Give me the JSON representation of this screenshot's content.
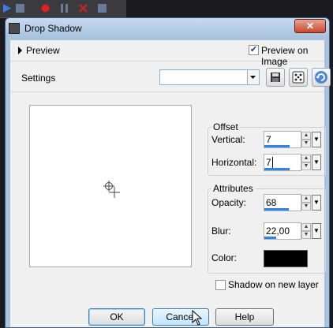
{
  "window": {
    "title": "Drop Shadow",
    "close_symbol": "✕"
  },
  "preview": {
    "expander_label": "Preview",
    "preview_on_image_label": "Preview on Image",
    "preview_on_image_checked": true
  },
  "settings": {
    "label": "Settings",
    "value": ""
  },
  "offset": {
    "group_label": "Offset",
    "vertical_label": "Vertical:",
    "vertical_value": "7",
    "horizontal_label": "Horizontal:",
    "horizontal_value": "7"
  },
  "attributes": {
    "group_label": "Attributes",
    "opacity_label": "Opacity:",
    "opacity_value": "68",
    "blur_label": "Blur:",
    "blur_value": "22,00",
    "color_label": "Color:",
    "shadow_color": "#000000"
  },
  "shadow_on_new_layer": {
    "label": "Shadow on new layer",
    "checked": false
  },
  "buttons": {
    "ok": "OK",
    "cancel": "Cancel",
    "help": "Help"
  }
}
